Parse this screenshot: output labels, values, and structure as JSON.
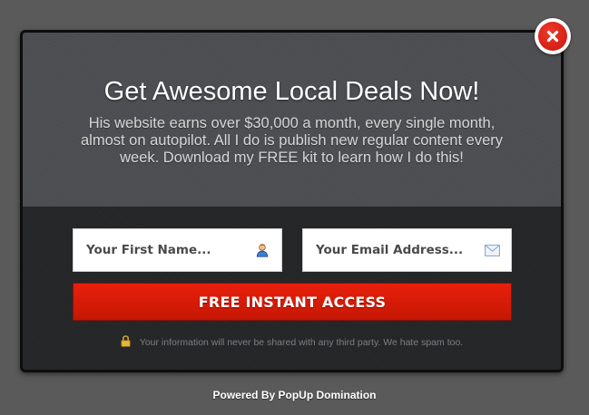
{
  "popup": {
    "headline": "Get Awesome Local Deals Now!",
    "subtext": "His website earns over $30,000 a month, every single month, almost on autopilot. All I do is publish new regular content every week. Download my FREE kit to learn how I do this!",
    "form": {
      "first_name_placeholder": "Your First Name...",
      "first_name_value": "",
      "first_name_icon": "user-icon",
      "email_placeholder": "Your Email Address...",
      "email_value": "",
      "email_icon": "envelope-icon",
      "submit_label": "FREE INSTANT ACCESS"
    },
    "privacy_text": "Your information will never be shared with any third party. We hate spam too.",
    "privacy_icon": "lock-icon",
    "close_icon": "close-icon"
  },
  "footer": {
    "powered_by": "Powered By PopUp Domination"
  },
  "colors": {
    "page_background": "#5a5a5a",
    "top_panel": "#4e5053",
    "bottom_panel": "#242527",
    "button_red": "#d81b08",
    "close_red": "#e0261a"
  }
}
